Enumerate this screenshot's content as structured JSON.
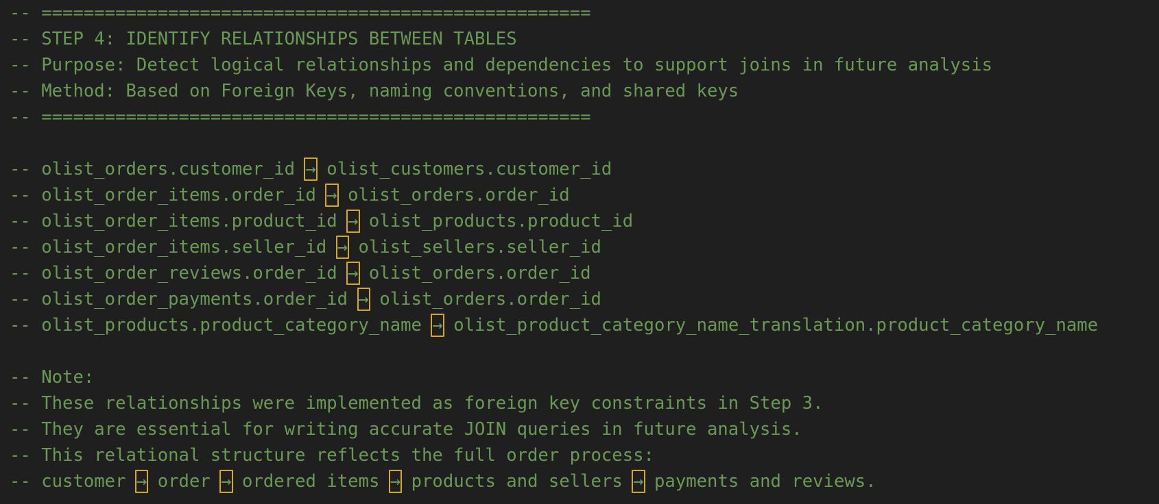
{
  "editor": {
    "lines": [
      "-- ====================================================",
      "-- STEP 4: IDENTIFY RELATIONSHIPS BETWEEN TABLES",
      "-- Purpose: Detect logical relationships and dependencies to support joins in future analysis",
      "-- Method: Based on Foreign Keys, naming conventions, and shared keys",
      "-- ====================================================",
      "",
      "-- olist_orders.customer_id → olist_customers.customer_id",
      "-- olist_order_items.order_id → olist_orders.order_id",
      "-- olist_order_items.product_id → olist_products.product_id",
      "-- olist_order_items.seller_id → olist_sellers.seller_id",
      "-- olist_order_reviews.order_id → olist_orders.order_id",
      "-- olist_order_payments.order_id → olist_orders.order_id",
      "-- olist_products.product_category_name → olist_product_category_name_translation.product_category_name",
      "",
      "-- Note:",
      "-- These relationships were implemented as foreign key constraints in Step 3.",
      "-- They are essential for writing accurate JOIN queries in future analysis.",
      "-- This relational structure reflects the full order process:",
      "-- customer → order → ordered items → products and sellers → payments and reviews."
    ],
    "arrow_glyph": "→",
    "highlight_color": "#d7a72a",
    "comment_color": "#6a9955",
    "background_color": "#1f1f1f"
  }
}
